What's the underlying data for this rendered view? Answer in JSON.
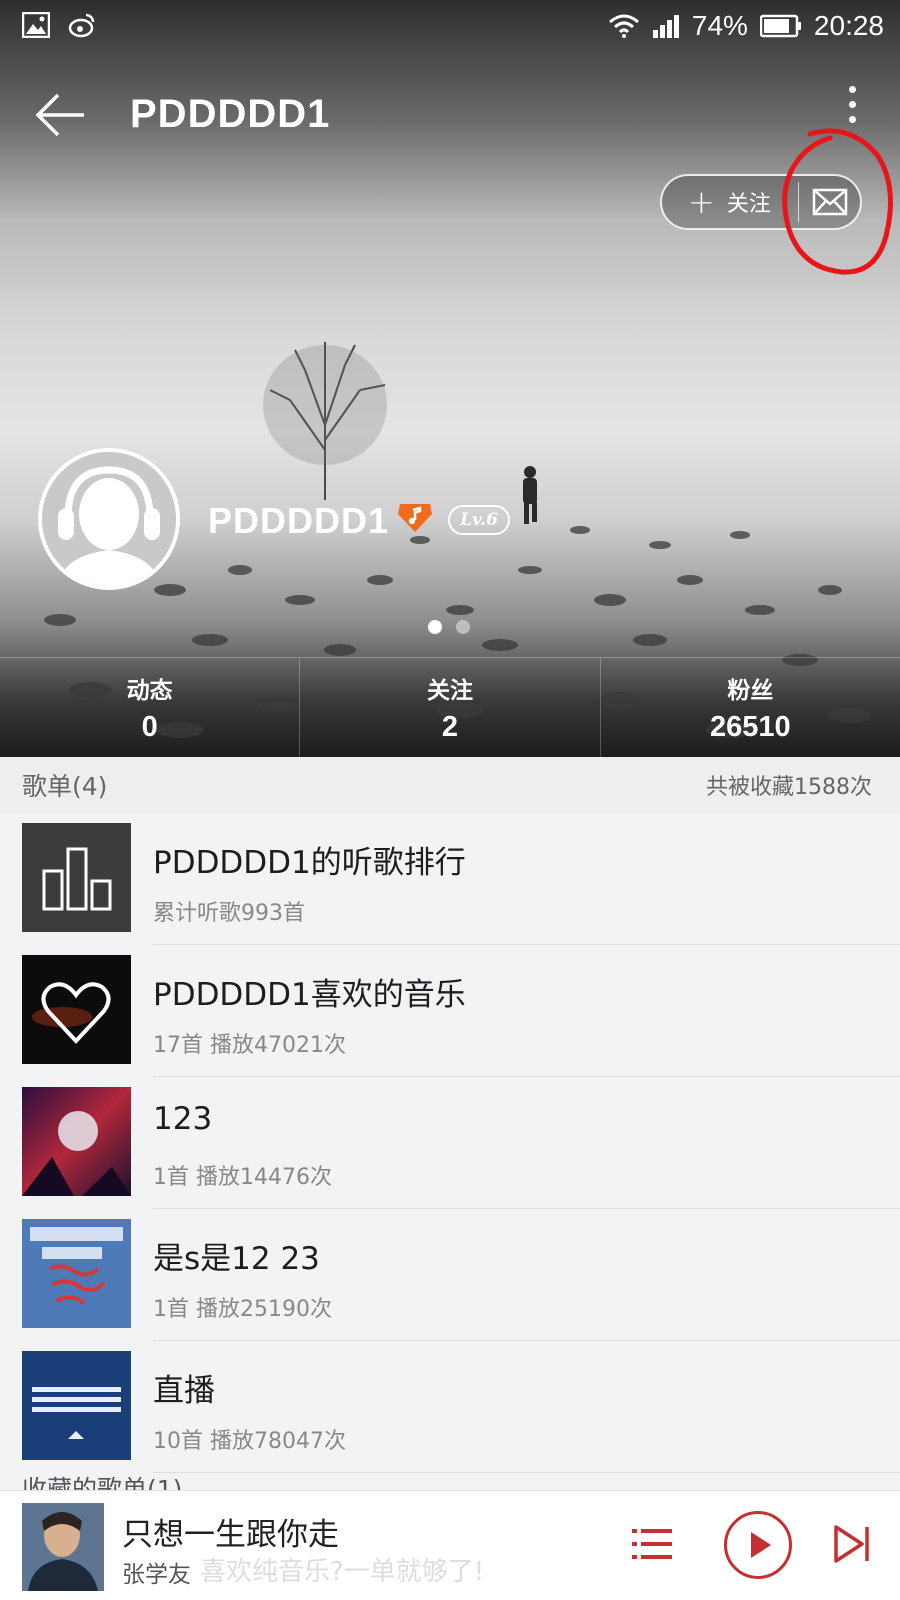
{
  "status_bar": {
    "battery": "74%",
    "time": "20:28"
  },
  "header": {
    "title": "PDDDDD1",
    "follow_label": "关注"
  },
  "profile": {
    "username": "PDDDDD1",
    "level": "Lv.6"
  },
  "stats": [
    {
      "label": "动态",
      "value": "0"
    },
    {
      "label": "关注",
      "value": "2"
    },
    {
      "label": "粉丝",
      "value": "26510"
    }
  ],
  "playlists_section": {
    "title": "歌单(4)",
    "meta": "共被收藏1588次"
  },
  "playlists": [
    {
      "title": "PDDDDD1的听歌排行",
      "subtitle": "累计听歌993首"
    },
    {
      "title": "PDDDDD1喜欢的音乐",
      "subtitle": "17首 播放47021次"
    },
    {
      "title": "123",
      "subtitle": "1首 播放14476次"
    },
    {
      "title": "是s是12 23",
      "subtitle": "1首 播放25190次"
    },
    {
      "title": "直播",
      "subtitle": "10首 播放78047次"
    }
  ],
  "collected_section": {
    "title": "收藏的歌单(1)"
  },
  "mini_player": {
    "song": "只想一生跟你走",
    "artist": "张学友",
    "overlay_text": "喜欢纯音乐?一单就够了!"
  },
  "colors": {
    "accent_red": "#c62f2f",
    "annotation_red": "#e8151b",
    "vip_orange": "#f26b1d"
  }
}
